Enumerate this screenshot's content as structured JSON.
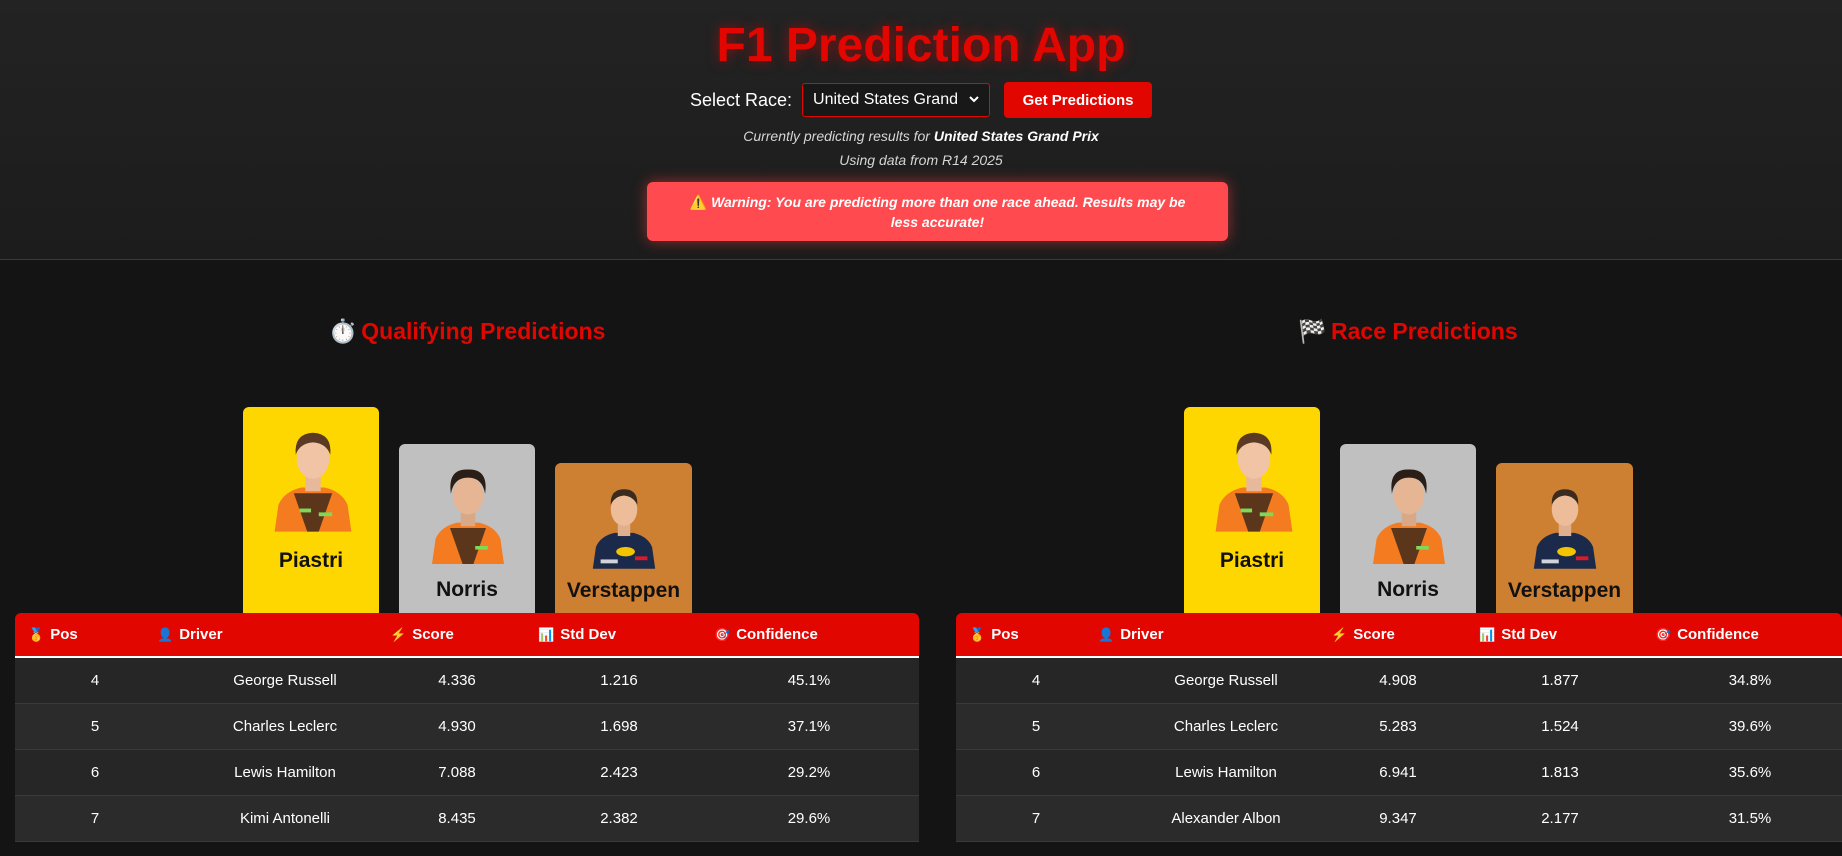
{
  "app": {
    "title": "F1 Prediction App",
    "select_label": "Select Race:",
    "selected_race": "United States Grand Prix",
    "predict_button": "Get Predictions",
    "predicting_prefix": "Currently predicting results for",
    "predicting_race": "United States Grand Prix",
    "data_prefix": "Using data from",
    "data_source": "R14 2025",
    "warning_icon": "warning-icon",
    "warning_text": "Warning: You are predicting more than one race ahead. Results may be less accurate!"
  },
  "colors": {
    "accent": "#e10600",
    "warning": "#ff4b4f",
    "gold": "#ffd700",
    "silver": "#c0c0c0",
    "bronze": "#cd7f32"
  },
  "columns": [
    {
      "label": "Pos",
      "icon": "medal-icon"
    },
    {
      "label": "Driver",
      "icon": "person-icon"
    },
    {
      "label": "Score",
      "icon": "lightning-icon"
    },
    {
      "label": "Std Dev",
      "icon": "bar-chart-icon"
    },
    {
      "label": "Confidence",
      "icon": "target-icon"
    }
  ],
  "qualifying": {
    "title": "Qualifying Predictions",
    "title_icon": "stopwatch-icon",
    "podium": [
      {
        "place": 1,
        "name": "Piastri"
      },
      {
        "place": 2,
        "name": "Norris"
      },
      {
        "place": 3,
        "name": "Verstappen"
      }
    ],
    "rows": [
      {
        "pos": "4",
        "driver": "George Russell",
        "score": "4.336",
        "std": "1.216",
        "conf": "45.1%"
      },
      {
        "pos": "5",
        "driver": "Charles Leclerc",
        "score": "4.930",
        "std": "1.698",
        "conf": "37.1%"
      },
      {
        "pos": "6",
        "driver": "Lewis Hamilton",
        "score": "7.088",
        "std": "2.423",
        "conf": "29.2%"
      },
      {
        "pos": "7",
        "driver": "Kimi Antonelli",
        "score": "8.435",
        "std": "2.382",
        "conf": "29.6%"
      }
    ]
  },
  "race": {
    "title": "Race Predictions",
    "title_icon": "checkered-flag-icon",
    "podium": [
      {
        "place": 1,
        "name": "Piastri"
      },
      {
        "place": 2,
        "name": "Norris"
      },
      {
        "place": 3,
        "name": "Verstappen"
      }
    ],
    "rows": [
      {
        "pos": "4",
        "driver": "George Russell",
        "score": "4.908",
        "std": "1.877",
        "conf": "34.8%"
      },
      {
        "pos": "5",
        "driver": "Charles Leclerc",
        "score": "5.283",
        "std": "1.524",
        "conf": "39.6%"
      },
      {
        "pos": "6",
        "driver": "Lewis Hamilton",
        "score": "6.941",
        "std": "1.813",
        "conf": "35.6%"
      },
      {
        "pos": "7",
        "driver": "Alexander Albon",
        "score": "9.347",
        "std": "2.177",
        "conf": "31.5%"
      }
    ]
  }
}
